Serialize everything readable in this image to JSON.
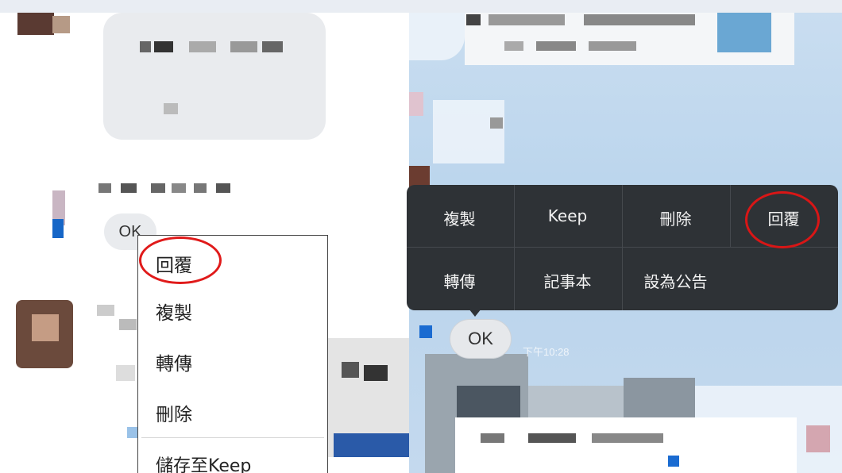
{
  "left_chat": {
    "message_text": "OK",
    "context_menu": {
      "items": [
        "回覆",
        "複製",
        "轉傳",
        "刪除",
        "儲存至Keep"
      ],
      "highlighted_item": "回覆"
    }
  },
  "right_chat": {
    "message_text": "OK",
    "timestamp": "下午10:28",
    "context_menu": {
      "row1": [
        "複製",
        "Keep",
        "刪除",
        "回覆"
      ],
      "row2": [
        "轉傳",
        "記事本",
        "設為公告"
      ],
      "highlighted_item": "回覆"
    }
  },
  "colors": {
    "highlight_circle": "#e01a1a",
    "dark_menu_bg": "#2e3236",
    "chat_bg_right": "#c9ddf0",
    "bubble_gray": "#e9ebee"
  }
}
